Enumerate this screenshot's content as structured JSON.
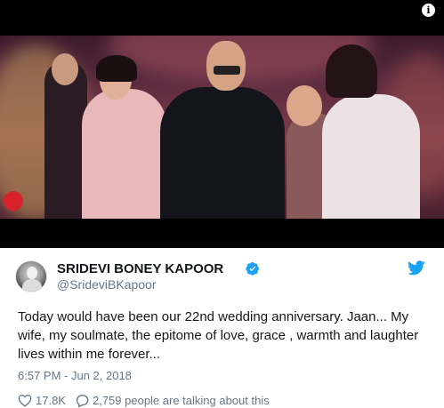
{
  "video": {
    "info_icon_glyph": "i",
    "info_icon": "info-icon",
    "logo_icon": "channel-logo-icon"
  },
  "tweet": {
    "display_name": "SRIDEVI BONEY KAPOOR",
    "handle": "@SrideviBKapoor",
    "verified": true,
    "text": "Today would have been our 22nd wedding anniversary. Jaan... My wife, my soulmate, the epitome of love, grace , warmth and laughter lives within me forever...",
    "timestamp": "6:57 PM - Jun 2, 2018",
    "likes": "17.8K",
    "conversation": "2,759 people are talking about this",
    "icons": {
      "verified": "verified-badge-icon",
      "twitter": "twitter-bird-icon",
      "like": "heart-icon",
      "reply": "speech-bubble-icon"
    },
    "colors": {
      "brand": "#1da1f2",
      "text": "#14171a",
      "secondary": "#657786"
    }
  }
}
